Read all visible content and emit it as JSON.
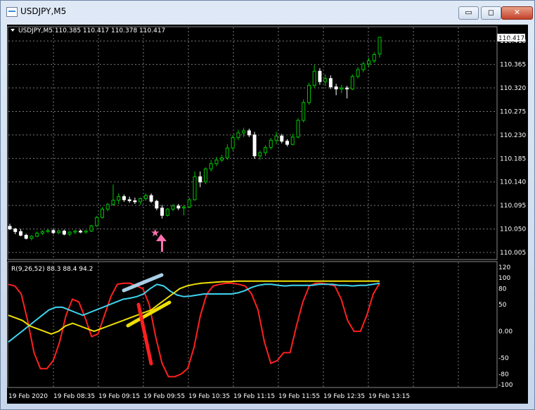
{
  "window": {
    "title": "USDJPY,M5"
  },
  "controls": {
    "min": "▭",
    "max": "◻",
    "close": "✕"
  },
  "price": {
    "header": "USDJPY,M5  110.385 110.417 110.378 110.417",
    "last": "110.417",
    "ticks": [
      "110.410",
      "110.365",
      "110.320",
      "110.275",
      "110.230",
      "110.185",
      "110.140",
      "110.095",
      "110.050",
      "110.005"
    ],
    "tick_values": [
      110.41,
      110.365,
      110.32,
      110.275,
      110.23,
      110.185,
      110.14,
      110.095,
      110.05,
      110.005
    ]
  },
  "oscillator": {
    "header": "R(9,26,52) 88.3 88.4 94.2",
    "ticks": [
      "120",
      "100",
      "80",
      "50",
      "0.00",
      "-50",
      "-80",
      "-100"
    ],
    "tick_values": [
      120,
      100,
      80,
      50,
      0,
      -50,
      -80,
      -100
    ]
  },
  "time_labels": [
    "19 Feb 2020",
    "19 Feb 08:35",
    "19 Feb 09:15",
    "19 Feb 09:55",
    "19 Feb 10:35",
    "19 Feb 11:15",
    "19 Feb 11:55",
    "19 Feb 12:35",
    "19 Feb 13:15"
  ],
  "colors": {
    "bull": "#00c400",
    "bear": "#ffffff",
    "r9": "#ff2020",
    "r26": "#3fd5ee",
    "r52": "#f0e000",
    "grid": "#7a7a7a"
  },
  "chart_data": {
    "type": "candlestick",
    "symbol": "USDJPY",
    "timeframe": "M5",
    "candles_ohlc": [
      [
        110.055,
        110.06,
        110.048,
        110.05
      ],
      [
        110.05,
        110.052,
        110.04,
        110.045
      ],
      [
        110.045,
        110.05,
        110.036,
        110.038
      ],
      [
        110.038,
        110.041,
        110.03,
        110.032
      ],
      [
        110.032,
        110.038,
        110.028,
        110.036
      ],
      [
        110.036,
        110.045,
        110.034,
        110.042
      ],
      [
        110.042,
        110.048,
        110.038,
        110.045
      ],
      [
        110.045,
        110.05,
        110.042,
        110.047
      ],
      [
        110.047,
        110.05,
        110.04,
        110.043
      ],
      [
        110.043,
        110.048,
        110.04,
        110.046
      ],
      [
        110.046,
        110.049,
        110.038,
        110.04
      ],
      [
        110.04,
        110.046,
        110.036,
        110.044
      ],
      [
        110.044,
        110.048,
        110.04,
        110.046
      ],
      [
        110.046,
        110.049,
        110.042,
        110.044
      ],
      [
        110.044,
        110.048,
        110.041,
        110.046
      ],
      [
        110.046,
        110.058,
        110.044,
        110.056
      ],
      [
        110.056,
        110.075,
        110.054,
        110.072
      ],
      [
        110.072,
        110.092,
        110.07,
        110.088
      ],
      [
        110.088,
        110.1,
        110.084,
        110.097
      ],
      [
        110.097,
        110.135,
        110.094,
        110.105
      ],
      [
        110.105,
        110.118,
        110.098,
        110.112
      ],
      [
        110.112,
        110.116,
        110.102,
        110.106
      ],
      [
        110.106,
        110.112,
        110.1,
        110.104
      ],
      [
        110.104,
        110.11,
        110.098,
        110.102
      ],
      [
        110.102,
        110.11,
        110.096,
        110.108
      ],
      [
        110.108,
        110.118,
        110.104,
        110.114
      ],
      [
        110.114,
        110.118,
        110.1,
        110.103
      ],
      [
        110.103,
        110.106,
        110.086,
        110.09
      ],
      [
        110.09,
        110.096,
        110.07,
        110.076
      ],
      [
        110.076,
        110.09,
        110.074,
        110.088
      ],
      [
        110.088,
        110.098,
        110.084,
        110.094
      ],
      [
        110.094,
        110.098,
        110.086,
        110.09
      ],
      [
        110.09,
        110.096,
        110.076,
        110.092
      ],
      [
        110.092,
        110.11,
        110.09,
        110.106
      ],
      [
        110.106,
        110.16,
        110.104,
        110.15
      ],
      [
        110.15,
        110.16,
        110.13,
        110.14
      ],
      [
        110.14,
        110.168,
        110.136,
        110.165
      ],
      [
        110.165,
        110.182,
        110.16,
        110.175
      ],
      [
        110.175,
        110.188,
        110.17,
        110.182
      ],
      [
        110.182,
        110.192,
        110.178,
        110.186
      ],
      [
        110.186,
        110.212,
        110.182,
        110.205
      ],
      [
        110.205,
        110.23,
        110.2,
        110.225
      ],
      [
        110.225,
        110.24,
        110.22,
        110.234
      ],
      [
        110.234,
        110.244,
        110.226,
        110.238
      ],
      [
        110.238,
        110.242,
        110.226,
        110.23
      ],
      [
        110.23,
        110.236,
        110.184,
        110.19
      ],
      [
        110.19,
        110.2,
        110.182,
        110.196
      ],
      [
        110.196,
        110.21,
        110.19,
        110.206
      ],
      [
        110.206,
        110.224,
        110.202,
        110.22
      ],
      [
        110.22,
        110.236,
        110.212,
        110.228
      ],
      [
        110.228,
        110.232,
        110.214,
        110.218
      ],
      [
        110.218,
        110.222,
        110.208,
        110.212
      ],
      [
        110.212,
        110.232,
        110.21,
        110.226
      ],
      [
        110.226,
        110.262,
        110.224,
        110.258
      ],
      [
        110.258,
        110.298,
        110.254,
        110.292
      ],
      [
        110.292,
        110.33,
        110.288,
        110.325
      ],
      [
        110.325,
        110.364,
        110.32,
        110.352
      ],
      [
        110.352,
        110.358,
        110.326,
        110.332
      ],
      [
        110.332,
        110.346,
        110.324,
        110.338
      ],
      [
        110.338,
        110.344,
        110.318,
        110.322
      ],
      [
        110.322,
        110.328,
        110.306,
        110.318
      ],
      [
        110.318,
        110.326,
        110.31,
        110.32
      ],
      [
        110.32,
        110.324,
        110.3,
        110.318
      ],
      [
        110.318,
        110.346,
        110.316,
        110.342
      ],
      [
        110.342,
        110.36,
        110.338,
        110.355
      ],
      [
        110.355,
        110.37,
        110.35,
        110.366
      ],
      [
        110.366,
        110.378,
        110.36,
        110.372
      ],
      [
        110.372,
        110.388,
        110.368,
        110.384
      ],
      [
        110.385,
        110.417,
        110.378,
        110.417
      ]
    ],
    "oscillator_series": [
      {
        "name": "R9",
        "values": [
          88,
          85,
          70,
          20,
          -40,
          -70,
          -70,
          -55,
          -20,
          30,
          60,
          55,
          25,
          -10,
          -5,
          30,
          65,
          88,
          90,
          90,
          85,
          80,
          50,
          -10,
          -60,
          -85,
          -85,
          -80,
          -70,
          -30,
          30,
          70,
          85,
          88,
          90,
          90,
          88,
          85,
          70,
          40,
          -20,
          -60,
          -55,
          -40,
          -40,
          10,
          55,
          85,
          90,
          90,
          88,
          85,
          60,
          20,
          0,
          0,
          30,
          70,
          90
        ]
      },
      {
        "name": "R26",
        "values": [
          -20,
          -10,
          0,
          10,
          20,
          30,
          40,
          45,
          45,
          40,
          35,
          30,
          35,
          40,
          45,
          50,
          55,
          60,
          62,
          65,
          70,
          80,
          88,
          85,
          75,
          68,
          65,
          66,
          68,
          70,
          70,
          70,
          70,
          70,
          72,
          76,
          82,
          86,
          88,
          88,
          86,
          85,
          86,
          86,
          86,
          86,
          88,
          88,
          88,
          86,
          86,
          85,
          86,
          86,
          88,
          90
        ]
      },
      {
        "name": "R52",
        "values": [
          30,
          25,
          20,
          10,
          5,
          0,
          -5,
          0,
          10,
          15,
          10,
          5,
          0,
          5,
          10,
          15,
          20,
          25,
          30,
          35,
          40,
          50,
          60,
          70,
          80,
          85,
          88,
          90,
          91,
          92,
          93,
          93,
          94,
          94,
          94,
          94,
          94,
          94,
          94,
          94,
          94,
          94,
          94,
          94,
          94,
          94,
          94,
          94,
          94,
          94,
          94,
          94,
          94
        ]
      }
    ]
  }
}
